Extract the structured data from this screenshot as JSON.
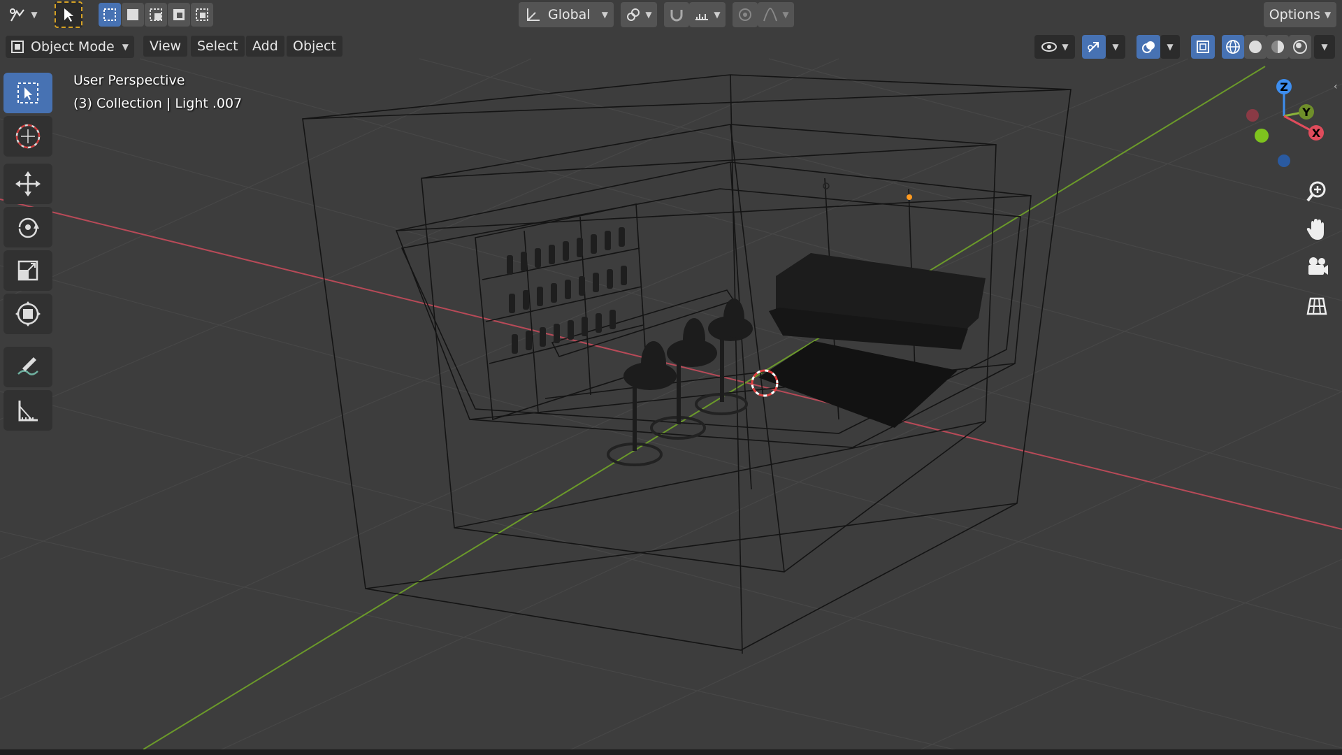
{
  "topbar": {
    "transform_orientation": "Global",
    "options_label": "Options"
  },
  "header": {
    "mode_label": "Object Mode",
    "menus": [
      "View",
      "Select",
      "Add",
      "Object"
    ]
  },
  "viewport": {
    "view_name": "User Perspective",
    "active_info": "(3) Collection | Light .007",
    "colors": {
      "background": "#3d3d3d",
      "grid": "#4a4a4a",
      "x_axis": "#b84a58",
      "y_axis": "#6b9a2a",
      "wire": "#111111",
      "accent": "#4772b3"
    }
  },
  "gizmo": {
    "z_label": "Z",
    "y_label": "Y",
    "x_label": "X",
    "colors": {
      "x": "#e04c5c",
      "y": "#8bb33a",
      "z": "#3d8ef0"
    }
  },
  "toolbar": {
    "tools": [
      "select-box",
      "cursor",
      "move",
      "rotate",
      "scale",
      "transform",
      "annotate",
      "measure"
    ]
  },
  "nav": {
    "buttons": [
      "zoom-icon",
      "hand-icon",
      "camera-icon",
      "grid-icon"
    ]
  }
}
